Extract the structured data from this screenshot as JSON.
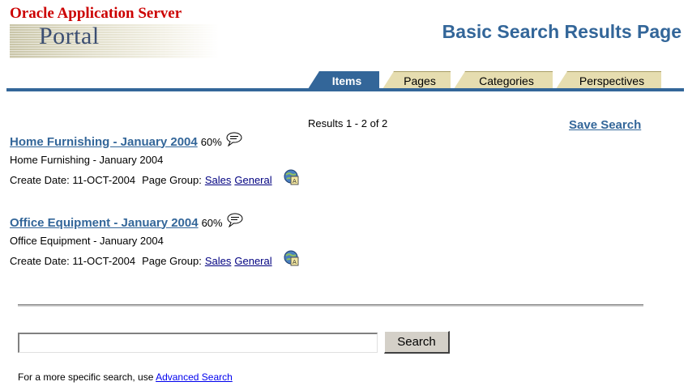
{
  "brand": {
    "top_text": "Oracle Application Server",
    "portal_text": "Portal"
  },
  "header": {
    "title": "Basic Search Results Page"
  },
  "tabs": [
    {
      "label": "Items",
      "active": true
    },
    {
      "label": "Pages",
      "active": false
    },
    {
      "label": "Categories",
      "active": false
    },
    {
      "label": "Perspectives",
      "active": false
    }
  ],
  "results_summary": "Results 1 - 2 of 2",
  "save_search_label": "Save Search",
  "results": [
    {
      "title": "Home Furnishing - January 2004",
      "score": "60%",
      "description": "Home Furnishing - January 2004",
      "create_date_label": "Create Date: 11-OCT-2004",
      "page_group_label": "Page Group:",
      "page_group_links": [
        "Sales",
        "General"
      ]
    },
    {
      "title": "Office Equipment - January 2004",
      "score": "60%",
      "description": "Office Equipment - January 2004",
      "create_date_label": "Create Date: 11-OCT-2004",
      "page_group_label": "Page Group:",
      "page_group_links": [
        "Sales",
        "General"
      ]
    }
  ],
  "search": {
    "value": "",
    "button_label": "Search"
  },
  "hint": {
    "prefix": "For a more specific search, use ",
    "link": "Advanced Search"
  },
  "colors": {
    "accent": "#336699",
    "brand_red": "#cc0000",
    "tab_inactive": "#e6ddb0"
  },
  "icons": {
    "comment": "speech-bubble-icon",
    "attribute": "globe-document-icon"
  }
}
